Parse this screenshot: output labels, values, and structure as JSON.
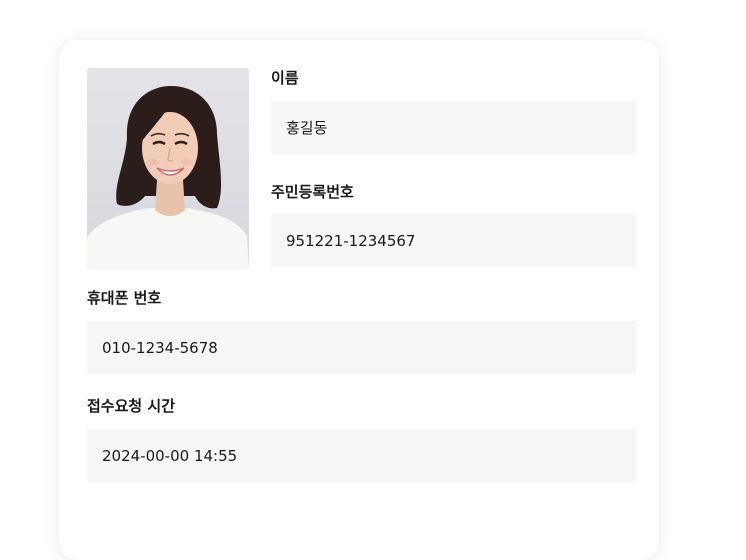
{
  "profile": {
    "photo_alt": "증명사진"
  },
  "fields": {
    "name": {
      "label": "이름",
      "value": "홍길동"
    },
    "resident_number": {
      "label": "주민등록번호",
      "value": "951221-1234567"
    },
    "phone": {
      "label": "휴대폰 번호",
      "value": "010-1234-5678"
    },
    "request_time": {
      "label": "접수요청 시간",
      "value": "2024-00-00 14:55"
    }
  }
}
